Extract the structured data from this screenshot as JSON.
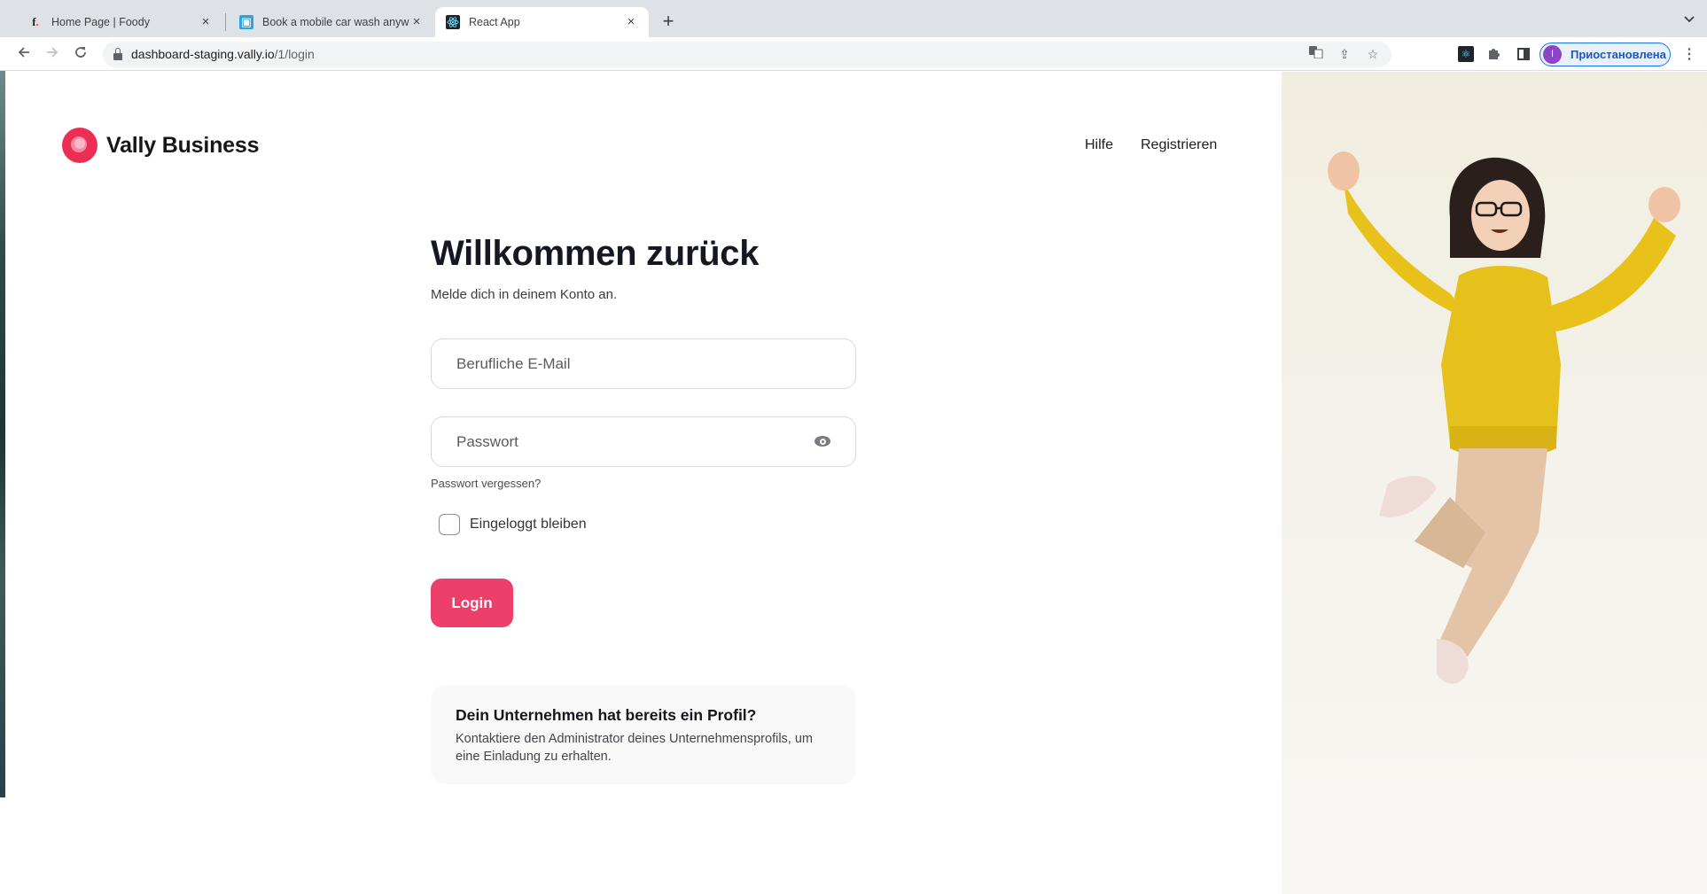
{
  "browser": {
    "tabs": [
      {
        "title": "Home Page | Foody",
        "favicon": "foody-f-icon",
        "active": false
      },
      {
        "title": "Book a mobile car wash anywhere",
        "favicon": "car-wash-icon",
        "active": false
      },
      {
        "title": "React App",
        "favicon": "react-icon",
        "active": true
      }
    ],
    "new_tab_symbol": "+",
    "tab_close_symbol": "×",
    "tab_search_symbol": "⌄",
    "url_host": "dashboard-staging.vally.io",
    "url_path": "/1/login",
    "profile_initial": "I",
    "profile_status": "Приостановлена"
  },
  "header": {
    "brand": "Vally Business",
    "brand_color": "#ec2e55",
    "nav": {
      "help": "Hilfe",
      "register": "Registrieren"
    }
  },
  "login": {
    "title": "Willkommen zurück",
    "subtitle": "Melde dich in deinem Konto an.",
    "email": {
      "value": "",
      "placeholder": "Berufliche E-Mail"
    },
    "password": {
      "value": "",
      "placeholder": "Passwort"
    },
    "forgot_password": "Passwort vergessen?",
    "remember_me": {
      "label": "Eingeloggt bleiben",
      "checked": false
    },
    "submit": "Login",
    "accent_color": "#ec3f6a"
  },
  "info": {
    "title": "Dein Unternehmen hat bereits ein Profil?",
    "text": "Kontaktiere den Administrator deines Unternehmensprofils, um eine Einladung zu erhalten."
  },
  "illustration": {
    "description": "3D character jumping, yellow sweater, beige pants"
  }
}
